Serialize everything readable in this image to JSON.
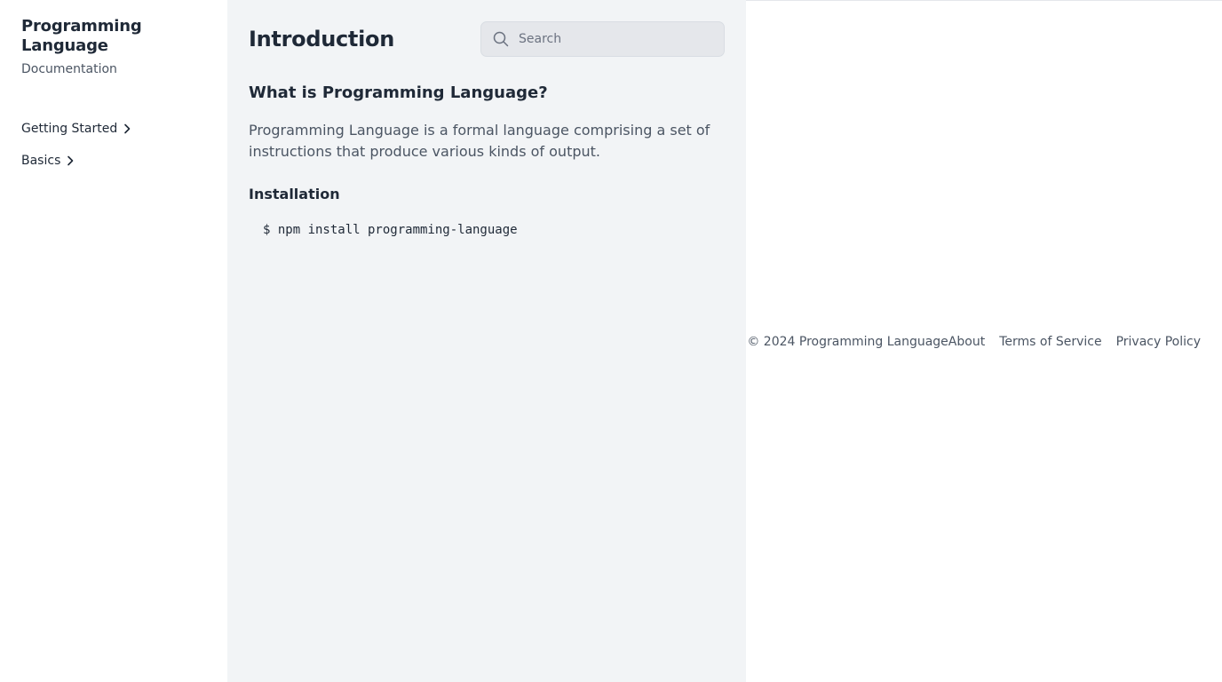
{
  "brand": {
    "title": "Programming Language",
    "subtitle": "Documentation"
  },
  "sidebar": {
    "items": [
      {
        "label": "Getting Started",
        "icon": "chevron-right-icon"
      },
      {
        "label": "Basics",
        "icon": "chevron-right-icon"
      }
    ]
  },
  "main": {
    "title": "Introduction",
    "search": {
      "placeholder": "Search",
      "value": "",
      "icon": "search-icon"
    },
    "section_heading": "What is Programming Language?",
    "intro_text": "Programming Language is a formal language comprising a set of instructions that produce various kinds of output.",
    "install_heading": "Installation",
    "install_command": "$ npm install programming-language"
  },
  "footer": {
    "copyright": "© 2024 Programming Language",
    "links": [
      "About",
      "Terms of Service",
      "Privacy Policy"
    ]
  },
  "colors": {
    "main_bg": "#f2f4f6",
    "text_primary": "#1f2937",
    "text_secondary": "#4b5563",
    "search_bg": "#e5e7eb"
  }
}
